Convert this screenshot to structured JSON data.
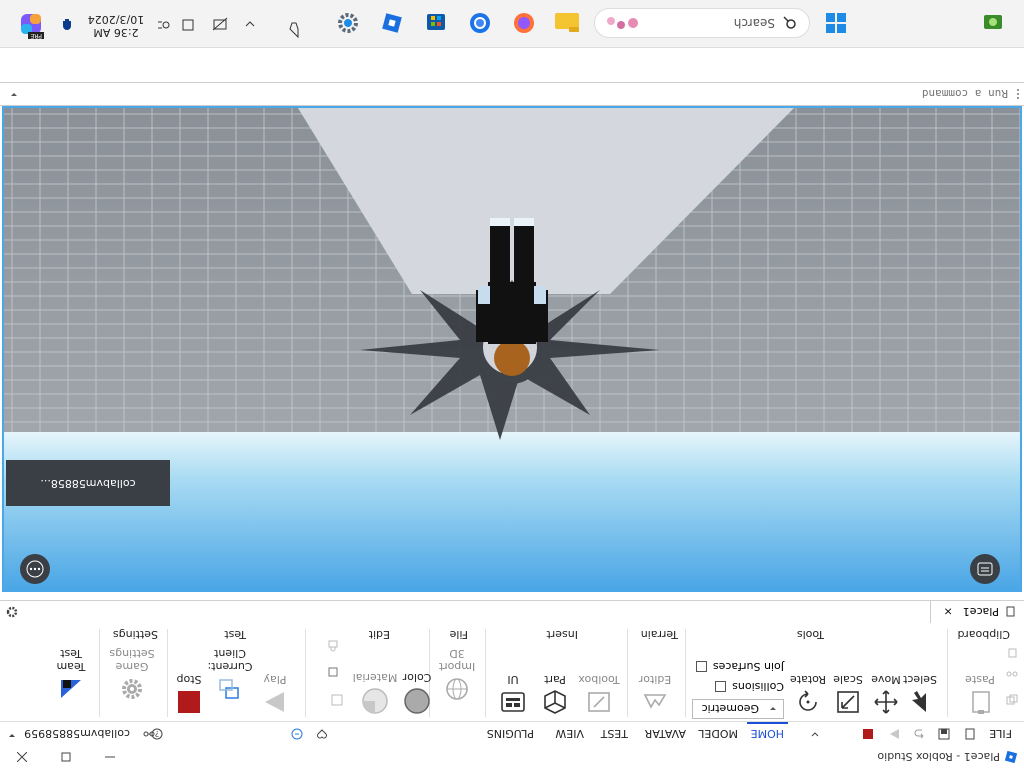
{
  "window": {
    "title": "Place1 - Roblox Studio",
    "app_icon": "roblox-studio-icon",
    "controls": [
      "minimize",
      "maximize",
      "close"
    ]
  },
  "menu": {
    "file": "FILE",
    "tabs": [
      "HOME",
      "MODEL",
      "AVATAR",
      "TEST",
      "VIEW",
      "PLUGINS"
    ],
    "active_tab": "HOME",
    "user": "collabvm58858959"
  },
  "ribbon": {
    "clipboard": {
      "label": "Clipboard",
      "paste": "Paste"
    },
    "tools": {
      "label": "Tools",
      "select": "Select",
      "move": "Move",
      "scale": "Scale",
      "rotate": "Rotate",
      "mode": "Geometric",
      "collisions": "Collisions",
      "join_surfaces": "Join Surfaces"
    },
    "terrain": {
      "label": "Terrain",
      "editor": "Editor"
    },
    "insert": {
      "label": "Insert",
      "toolbox": "Toolbox",
      "part": "Part",
      "ui": "UI"
    },
    "file": {
      "label": "File",
      "import3d": "Import\n3D"
    },
    "edit": {
      "label": "Edit",
      "color": "Color",
      "material": "Material"
    },
    "test": {
      "label": "Test",
      "play": "Play",
      "current_client": "Current:\nClient",
      "stop": "Stop"
    },
    "settings": {
      "label": "Settings",
      "game_settings": "Game\nSettings"
    },
    "team_test": {
      "label": "Team\nTest"
    }
  },
  "document_tabs": [
    {
      "label": "Place1",
      "close": "×"
    }
  ],
  "viewport": {
    "player_label": "collabvm58858...",
    "sky_color": "#7fc3ea",
    "baseplate_color": "#9aa0a6"
  },
  "command_bar": {
    "placeholder": "Run a command"
  },
  "taskbar": {
    "search_placeholder": "Search",
    "time": "2:36 AM",
    "date": "10/3/2024",
    "preview_badge": "PRE"
  }
}
